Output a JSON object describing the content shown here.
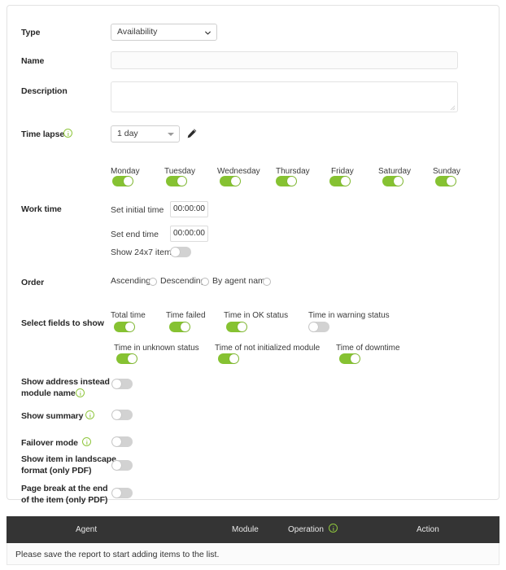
{
  "form": {
    "type": {
      "label": "Type",
      "value": "Availability",
      "icon": "chevron-down-icon"
    },
    "name": {
      "label": "Name",
      "value": "",
      "placeholder": ""
    },
    "description": {
      "label": "Description",
      "value": "",
      "placeholder": ""
    },
    "time_lapse": {
      "label": "Time lapse",
      "value": "1 day",
      "info_icon": "info-icon",
      "edit_icon": "pencil-icon"
    },
    "work_time": {
      "label": "Work time",
      "days": [
        {
          "name": "Monday",
          "enabled": true
        },
        {
          "name": "Tuesday",
          "enabled": true
        },
        {
          "name": "Wednesday",
          "enabled": true
        },
        {
          "name": "Thursday",
          "enabled": true
        },
        {
          "name": "Friday",
          "enabled": true
        },
        {
          "name": "Saturday",
          "enabled": true
        },
        {
          "name": "Sunday",
          "enabled": true
        }
      ],
      "initial_time_label": "Set initial time",
      "initial_time_value": "00:00:00",
      "end_time_label": "Set end time",
      "end_time_value": "00:00:00",
      "show_24x7_label": "Show 24x7 item",
      "show_24x7_enabled": false
    },
    "order": {
      "label": "Order",
      "options": [
        {
          "label": "Ascending",
          "selected": false
        },
        {
          "label": "Descending",
          "selected": false
        },
        {
          "label": "By agent name",
          "selected": false
        }
      ]
    },
    "select_fields": {
      "label": "Select fields to show",
      "row1": [
        {
          "label": "Total time",
          "enabled": true
        },
        {
          "label": "Time failed",
          "enabled": true
        },
        {
          "label": "Time in OK status",
          "enabled": true
        },
        {
          "label": "Time in warning status",
          "enabled": false
        }
      ],
      "row2": [
        {
          "label": "Time in unknown status",
          "enabled": true
        },
        {
          "label": "Time of not initialized module",
          "enabled": true
        },
        {
          "label": "Time of downtime",
          "enabled": true
        }
      ]
    },
    "options": [
      {
        "label_line1": "Show address instead",
        "label_line2": "module name",
        "has_info": true,
        "enabled": false
      },
      {
        "label_line1": "Show summary",
        "label_line2": "",
        "has_info": true,
        "enabled": false
      },
      {
        "label_line1": "Failover mode",
        "label_line2": "",
        "has_info": true,
        "enabled": false
      },
      {
        "label_line1": "Show item in landscape",
        "label_line2": "format (only  PDF)",
        "has_info": false,
        "enabled": false
      },
      {
        "label_line1": "Page break at the end",
        "label_line2": "of the item (only PDF)",
        "has_info": false,
        "enabled": false
      }
    ]
  },
  "items_table": {
    "columns": [
      {
        "label": "Agent",
        "has_info": false
      },
      {
        "label": "Module",
        "has_info": false
      },
      {
        "label": "Operation",
        "has_info": true
      },
      {
        "label": "Action",
        "has_info": false
      }
    ],
    "empty_message": "Please save the report to start adding items to the list."
  },
  "colors": {
    "toggle_on": "#86c232",
    "toggle_off": "#d2d2d2",
    "info_green": "#8fc63d",
    "table_header": "#343434"
  }
}
